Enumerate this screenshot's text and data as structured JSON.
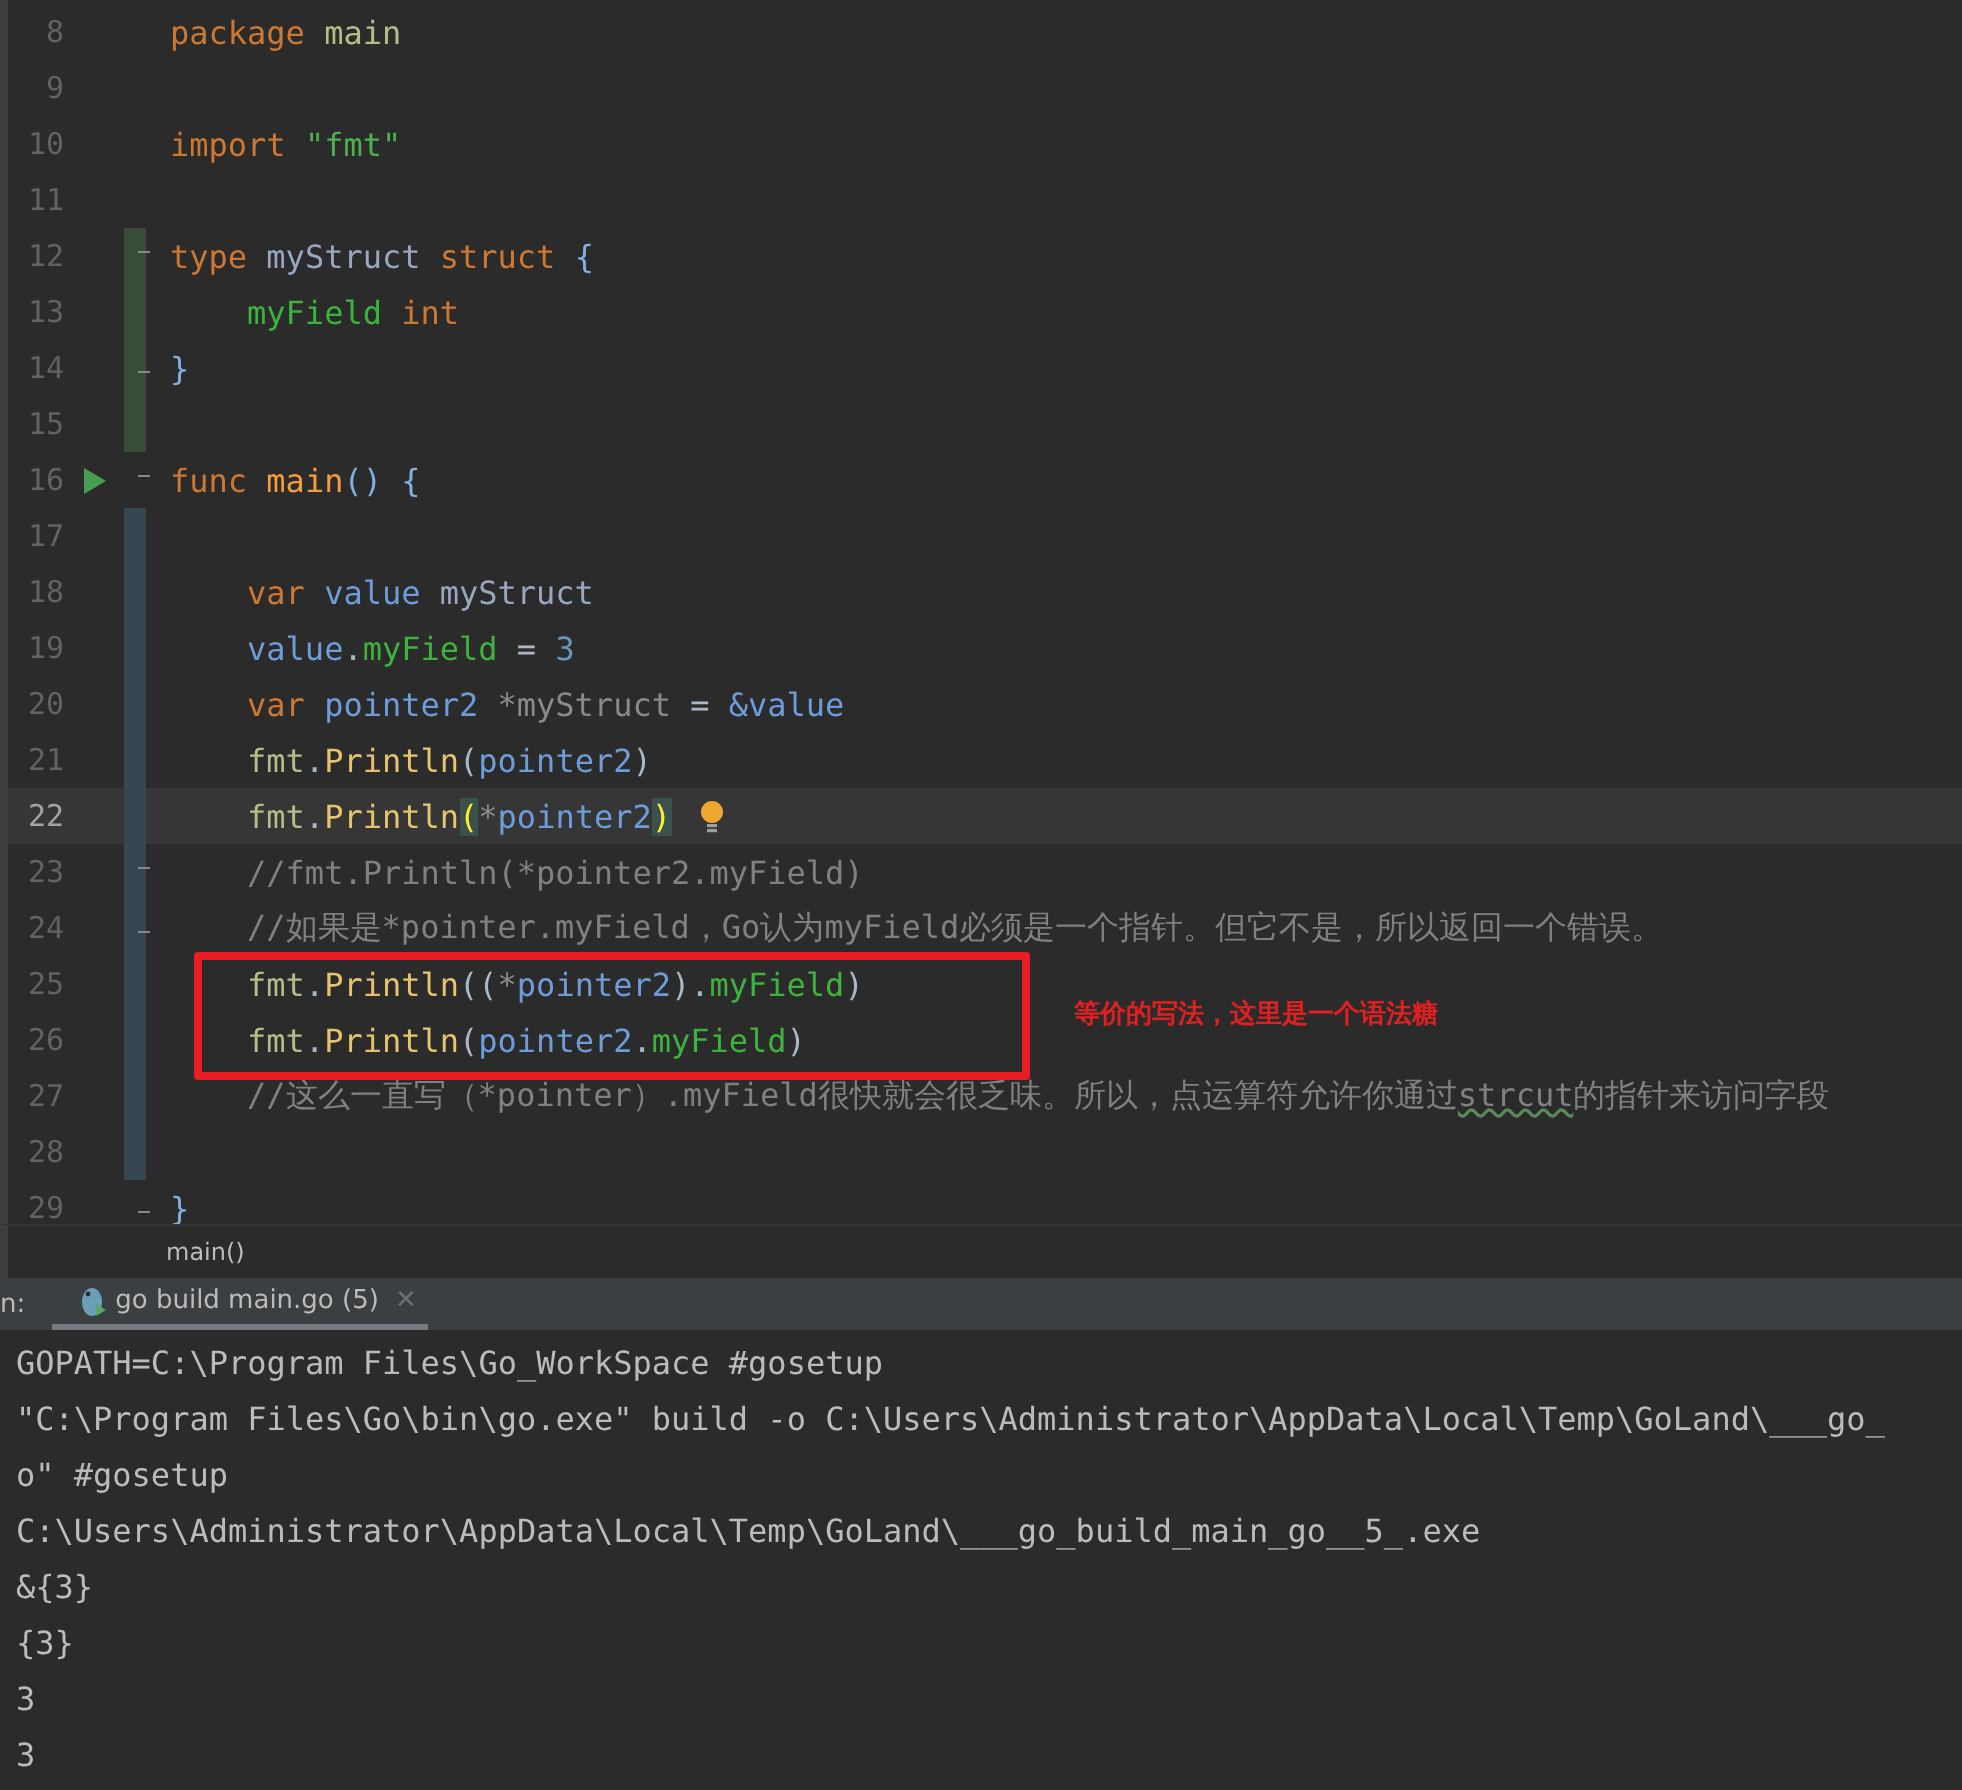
{
  "editor": {
    "lines": [
      {
        "number": "8",
        "current": false,
        "tokens": [
          {
            "kind": "kw",
            "text": "package "
          },
          {
            "kind": "pkg",
            "text": "main"
          }
        ]
      },
      {
        "number": "9",
        "current": false
      },
      {
        "number": "10",
        "current": false,
        "tokens": [
          {
            "kind": "kw",
            "text": "import "
          },
          {
            "kind": "str",
            "text": "\"fmt\""
          }
        ]
      },
      {
        "number": "11",
        "current": false
      },
      {
        "number": "12",
        "current": false,
        "added": true,
        "fold_start": true,
        "tokens": [
          {
            "kind": "kw",
            "text": "type "
          },
          {
            "kind": "type",
            "text": "myStruct "
          },
          {
            "kind": "kw",
            "text": "struct "
          },
          {
            "kind": "brace",
            "text": "{"
          }
        ]
      },
      {
        "number": "13",
        "current": false,
        "added": true,
        "tokens": [
          {
            "kind": "field",
            "text": "    myField "
          },
          {
            "kind": "kw",
            "text": "int"
          }
        ]
      },
      {
        "number": "14",
        "current": false,
        "added": true,
        "fold_end": true,
        "tokens": [
          {
            "kind": "brace",
            "text": "}"
          }
        ]
      },
      {
        "number": "15",
        "current": false,
        "added": true
      },
      {
        "number": "16",
        "current": false,
        "fold_start": true,
        "runnable": true,
        "tokens": [
          {
            "kind": "kw",
            "text": "func "
          },
          {
            "kind": "fndecl",
            "text": "main"
          },
          {
            "kind": "brace",
            "text": "() {"
          }
        ]
      },
      {
        "number": "17",
        "current": false,
        "modified": true
      },
      {
        "number": "18",
        "current": false,
        "modified": true,
        "tokens": [
          {
            "kind": "kw",
            "text": "    var "
          },
          {
            "kind": "var",
            "text": "value "
          },
          {
            "kind": "type",
            "text": "myStruct"
          }
        ]
      },
      {
        "number": "19",
        "current": false,
        "modified": true,
        "tokens": [
          {
            "kind": "var",
            "text": "    value"
          },
          {
            "kind": "plain",
            "text": "."
          },
          {
            "kind": "field",
            "text": "myField"
          },
          {
            "kind": "plain",
            "text": " = "
          },
          {
            "kind": "num",
            "text": "3"
          }
        ]
      },
      {
        "number": "20",
        "current": false,
        "modified": true,
        "tokens": [
          {
            "kind": "kw",
            "text": "    var "
          },
          {
            "kind": "var",
            "text": "pointer2 "
          },
          {
            "kind": "dim",
            "text": "*myStruct "
          },
          {
            "kind": "plain",
            "text": "= "
          },
          {
            "kind": "var",
            "text": "&value"
          }
        ]
      },
      {
        "number": "21",
        "current": false,
        "modified": true,
        "tokens": [
          {
            "kind": "pkg",
            "text": "    fmt"
          },
          {
            "kind": "plain",
            "text": "."
          },
          {
            "kind": "fn",
            "text": "Println"
          },
          {
            "kind": "plain",
            "text": "("
          },
          {
            "kind": "var",
            "text": "pointer2"
          },
          {
            "kind": "plain",
            "text": ")"
          }
        ]
      },
      {
        "number": "22",
        "current": true,
        "modified": true,
        "hint": true,
        "tokens": [
          {
            "kind": "pkg",
            "text": "    fmt"
          },
          {
            "kind": "plain",
            "text": "."
          },
          {
            "kind": "fn",
            "text": "Println"
          },
          {
            "kind": "match",
            "text": "("
          },
          {
            "kind": "dim",
            "text": "*"
          },
          {
            "kind": "var",
            "text": "pointer2"
          },
          {
            "kind": "match",
            "text": ")"
          }
        ]
      },
      {
        "number": "23",
        "current": false,
        "modified": true,
        "fold_start": true,
        "tokens": [
          {
            "kind": "comment",
            "text": "    //fmt.Println(*pointer2.myField)"
          }
        ]
      },
      {
        "number": "24",
        "current": false,
        "modified": true,
        "fold_end": true,
        "tokens": [
          {
            "kind": "comment",
            "text": "    //如果是*pointer.myField，Go认为myField必须是一个指针。但它不是，所以返回一个错误。"
          }
        ]
      },
      {
        "number": "25",
        "current": false,
        "modified": true,
        "tokens": [
          {
            "kind": "pkg",
            "text": "    fmt"
          },
          {
            "kind": "plain",
            "text": "."
          },
          {
            "kind": "fn",
            "text": "Println"
          },
          {
            "kind": "plain",
            "text": "(("
          },
          {
            "kind": "dim",
            "text": "*"
          },
          {
            "kind": "var",
            "text": "pointer2"
          },
          {
            "kind": "plain",
            "text": ")."
          },
          {
            "kind": "field",
            "text": "myField"
          },
          {
            "kind": "plain",
            "text": ")"
          }
        ]
      },
      {
        "number": "26",
        "current": false,
        "modified": true,
        "tokens": [
          {
            "kind": "pkg",
            "text": "    fmt"
          },
          {
            "kind": "plain",
            "text": "."
          },
          {
            "kind": "fn",
            "text": "Println"
          },
          {
            "kind": "plain",
            "text": "("
          },
          {
            "kind": "var",
            "text": "pointer2"
          },
          {
            "kind": "plain",
            "text": "."
          },
          {
            "kind": "field",
            "text": "myField"
          },
          {
            "kind": "plain",
            "text": ")"
          }
        ]
      },
      {
        "number": "27",
        "current": false,
        "modified": true,
        "tokens": [
          {
            "kind": "comment",
            "text": "    //这么一直写（*pointer）.myField很快就会很乏味。所以，点运算符允许你通过"
          },
          {
            "kind": "typo",
            "text": "strcut"
          },
          {
            "kind": "comment",
            "text": "的指针来访问字段"
          }
        ]
      },
      {
        "number": "28",
        "current": false,
        "modified": true
      },
      {
        "number": "29",
        "current": false,
        "fold_end": true,
        "tokens": [
          {
            "kind": "brace",
            "text": "}"
          }
        ]
      }
    ],
    "annotation": {
      "text": "等价的写法，这里是一个语法糖"
    },
    "breadcrumb": "main()"
  },
  "run_panel": {
    "label": "n:",
    "tabs": [
      {
        "label": "go build main.go (5)",
        "close": "✕",
        "selected": true
      }
    ],
    "console": [
      "GOPATH=C:\\Program Files\\Go_WorkSpace #gosetup",
      "\"C:\\Program Files\\Go\\bin\\go.exe\" build -o C:\\Users\\Administrator\\AppData\\Local\\Temp\\GoLand\\___go_",
      "o\" #gosetup",
      "C:\\Users\\Administrator\\AppData\\Local\\Temp\\GoLand\\___go_build_main_go__5_.exe",
      "&{3}",
      "{3}",
      "3",
      "3"
    ]
  }
}
